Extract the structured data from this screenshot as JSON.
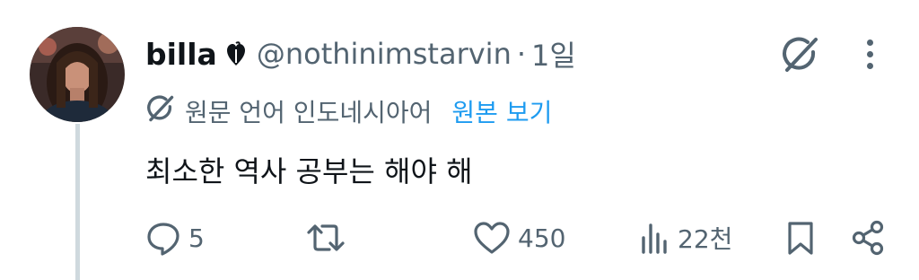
{
  "tweet": {
    "author": {
      "display_name": "billa",
      "badge_icon": "heart-leaf-emoji-icon",
      "handle": "@nothinimstarvin",
      "separator": "·",
      "time": "1일"
    },
    "translation": {
      "language_note": "원문 언어 인도네시아어",
      "show_original": "원본 보기"
    },
    "text": "최소한 역사 공부는 해야 해",
    "actions": {
      "replies": "5",
      "retweets": "",
      "likes": "450",
      "views": "22천"
    }
  },
  "icons": [
    "grok-icon",
    "more-icon",
    "translate-icon",
    "reply-icon",
    "retweet-icon",
    "like-icon",
    "views-icon",
    "bookmark-icon",
    "share-icon"
  ],
  "colors": {
    "link": "#1d9bf0",
    "muted": "#536471",
    "text": "#0f1419",
    "thread": "#cfd9de"
  }
}
